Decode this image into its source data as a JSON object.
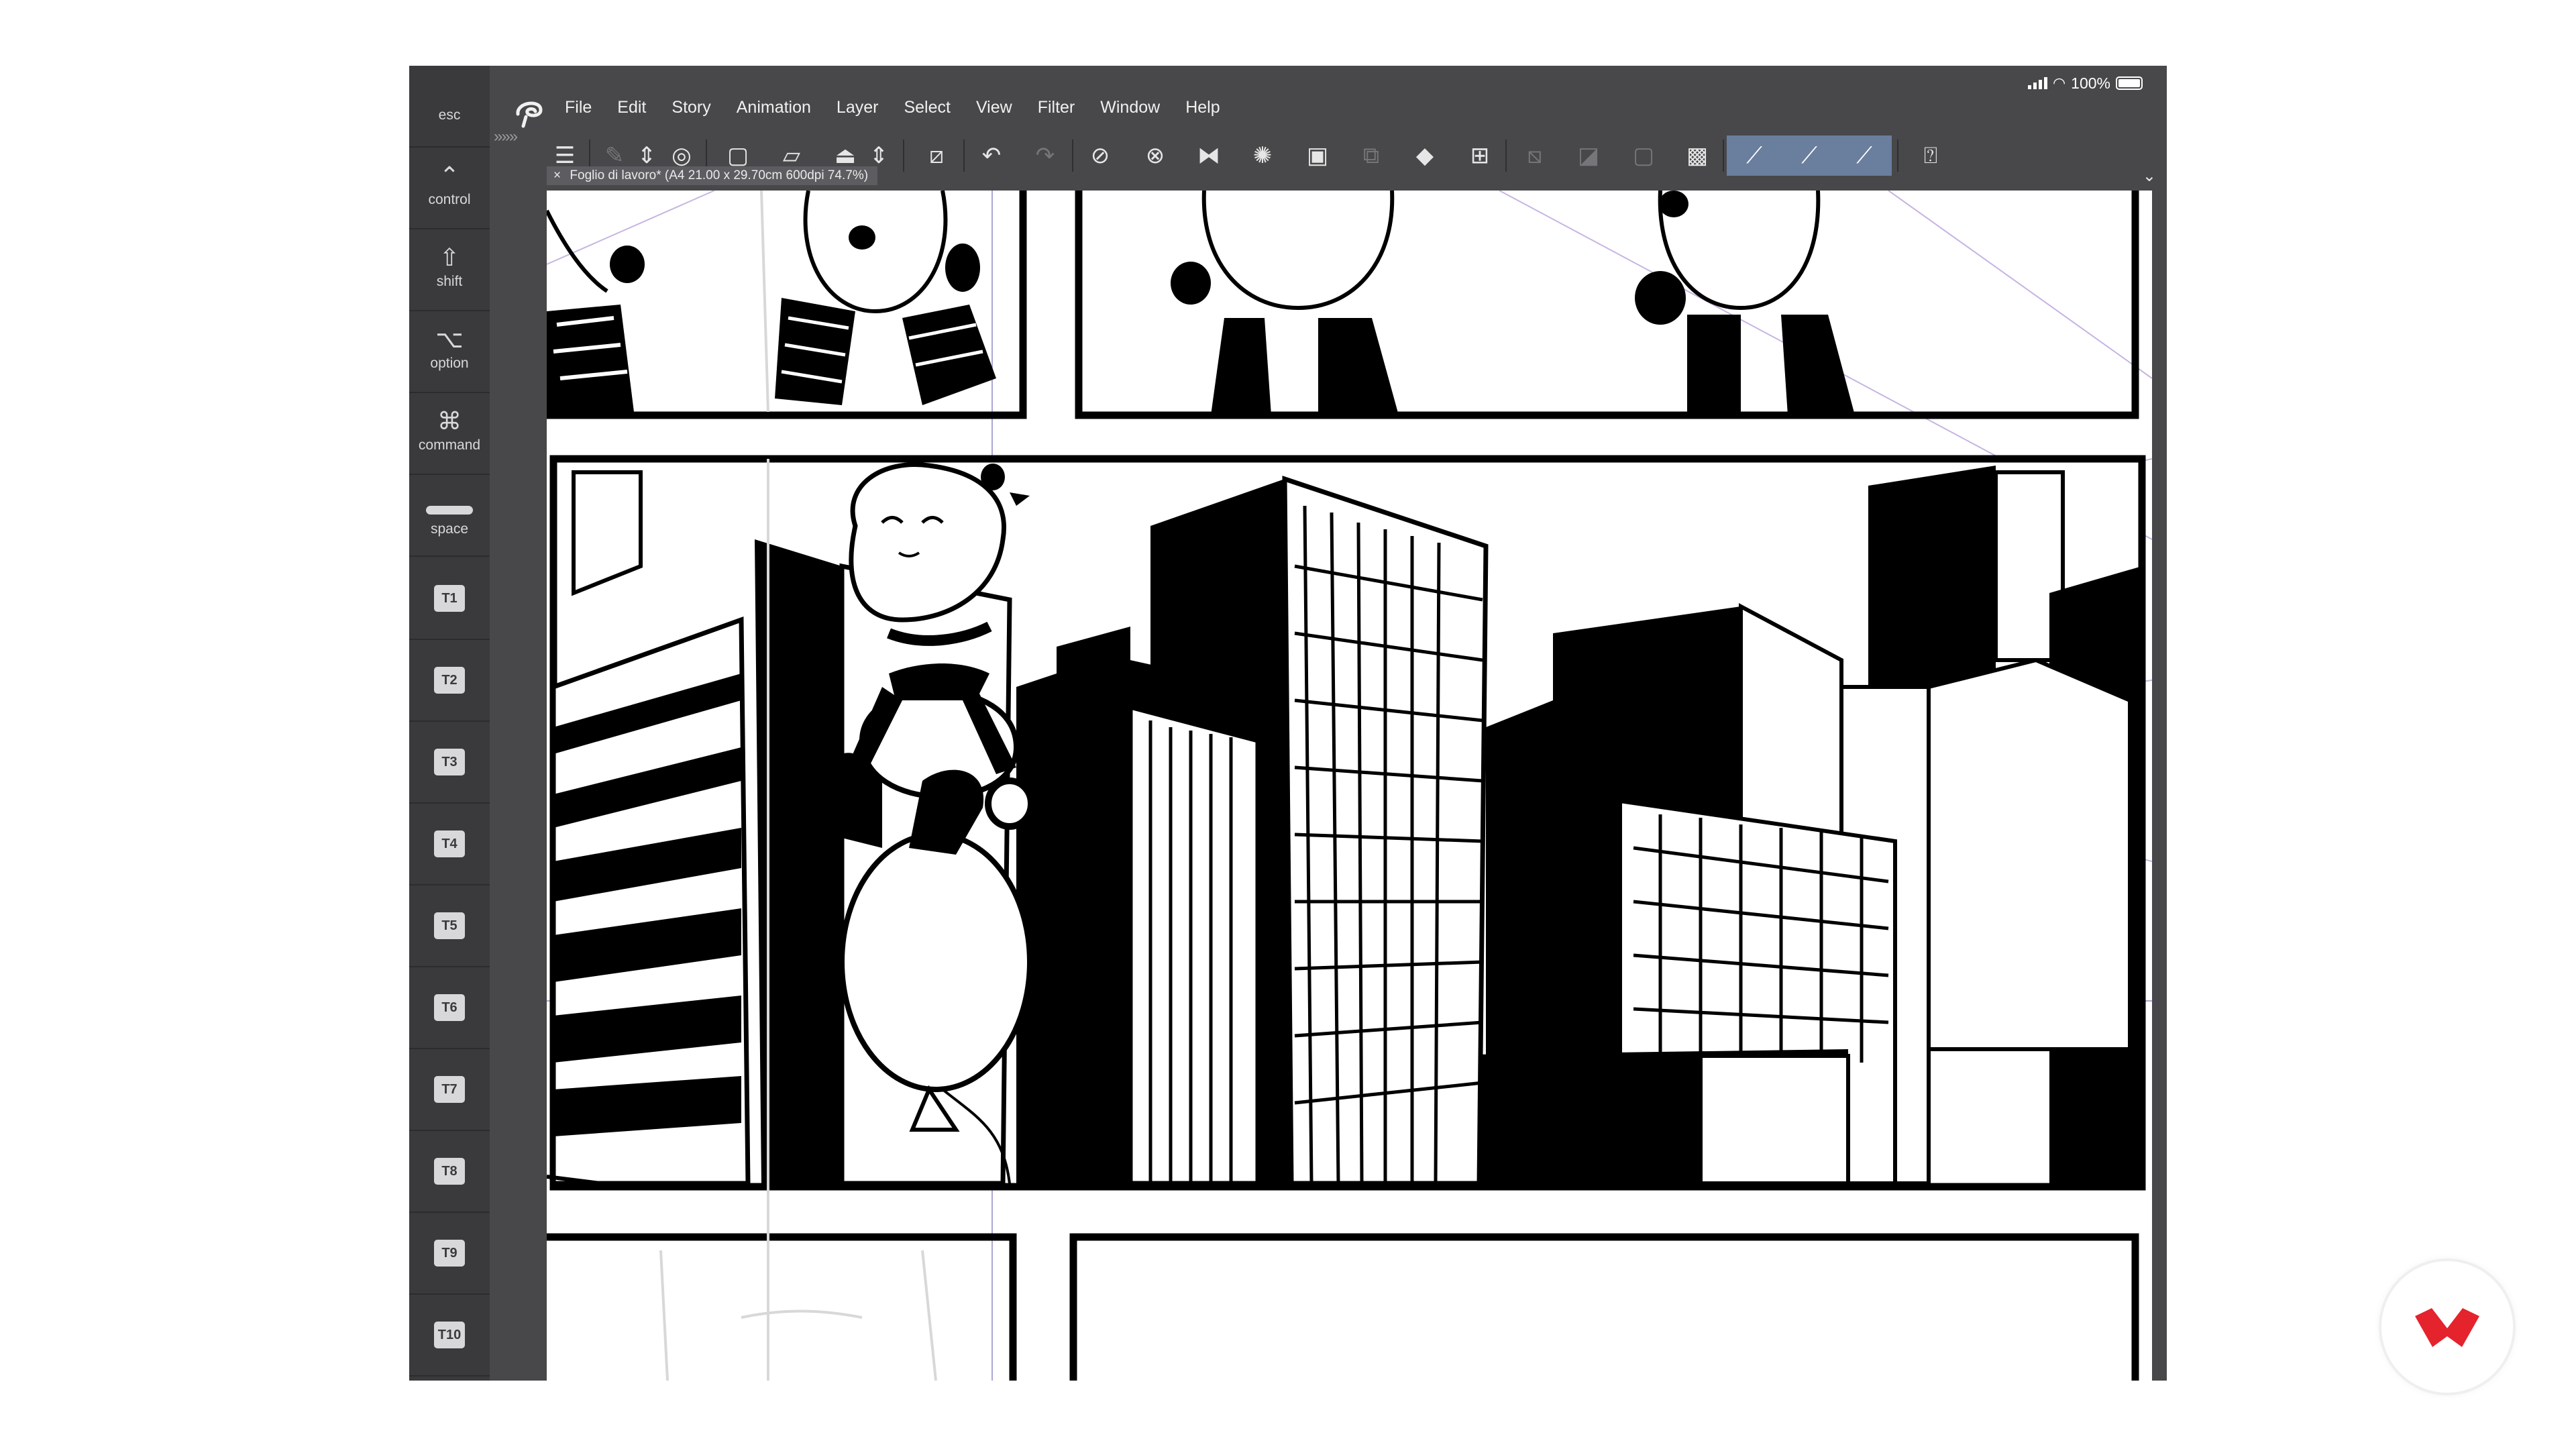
{
  "status_bar": {
    "battery_percent": "100%",
    "signal_icon": "cellular-signal-icon",
    "wifi_icon": "wifi-icon",
    "battery_icon": "battery-icon"
  },
  "modifier_keys": [
    {
      "label": "esc"
    },
    {
      "label": "control",
      "symbol": "⌃"
    },
    {
      "label": "shift",
      "symbol": "⇧"
    },
    {
      "label": "option",
      "symbol": "⌥"
    },
    {
      "label": "command",
      "symbol": "⌘"
    },
    {
      "label": "space"
    }
  ],
  "tool_keys": [
    "T1",
    "T2",
    "T3",
    "T4",
    "T5",
    "T6",
    "T7",
    "T8",
    "T9",
    "T10"
  ],
  "menu": [
    "File",
    "Edit",
    "Story",
    "Animation",
    "Layer",
    "Select",
    "View",
    "Filter",
    "Window",
    "Help"
  ],
  "toolbar": {
    "chevrons": "»»»",
    "icons": [
      "menu-icon",
      "new-page-icon",
      "up-down-arrows-icon",
      "layer-target-icon",
      "new-file-icon",
      "open-folder-icon",
      "export-icon",
      "up-down-arrows-icon",
      "transform-icon",
      "undo-icon",
      "redo-icon",
      "lasso-select-icon",
      "deselect-icon",
      "flip-icon",
      "loading-spinner-icon",
      "selection-layer-icon",
      "duplicate-icon",
      "fill-bucket-icon",
      "crop-icon",
      "hide-selection-icon",
      "gradient-icon",
      "square-icon",
      "snap-icon",
      "ruler-snap-icon",
      "brush-snap-icon",
      "pen-snap-icon",
      "help-icon"
    ]
  },
  "document": {
    "tab_title": "Foglio di lavoro* (A4 21.00 x 29.70cm 600dpi 74.7%)"
  },
  "colors": {
    "app_bg": "#48484a",
    "panel_bg": "#3a3a3c",
    "active_tool": "#6a7e9e",
    "brand_red": "#e4232d"
  }
}
